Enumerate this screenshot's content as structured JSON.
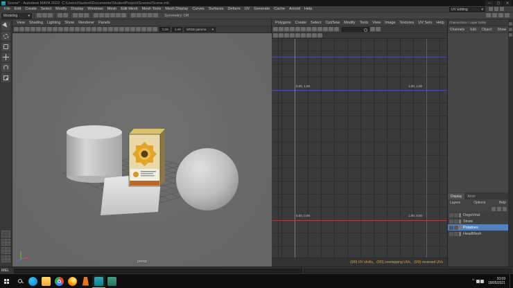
{
  "window": {
    "title": "Scene* - Autodesk MAYA 2022: C:\\Users\\Student\\Documents\\StudentProject\\Scenes\\Scene.mb",
    "minimize": "—",
    "maximize": "▢",
    "close": "✕"
  },
  "menubar": {
    "items": [
      "File",
      "Edit",
      "Create",
      "Select",
      "Modify",
      "Display",
      "Windows",
      "Mesh",
      "Edit Mesh",
      "Mesh Tools",
      "Mesh Display",
      "Curves",
      "Surfaces",
      "Deform",
      "UV",
      "Generate",
      "Cache",
      "Arnold",
      "Help"
    ],
    "workspace_value": "UV Editing",
    "right_icons": [
      "workspace-options-icon",
      "lock-ui-icon",
      "help-search-icon"
    ]
  },
  "statusline": {
    "menuset": "Modeling",
    "symmetry": "Symmetry: Off",
    "file_icons": [
      "new-scene-icon",
      "open-scene-icon",
      "save-scene-icon"
    ],
    "undo_icons": [
      "undo-icon",
      "redo-icon"
    ],
    "select_icons": [
      "select-hierarchy-icon",
      "select-object-icon",
      "select-component-icon"
    ],
    "snap_icons": [
      "snap-grid-icon",
      "snap-curve-icon",
      "snap-point-icon",
      "snap-projected-center-icon",
      "snap-view-plane-icon",
      "make-live-icon"
    ],
    "render_icons": [
      "construction-history-icon",
      "render-view-icon",
      "render-frame-icon",
      "ipr-render-icon",
      "render-settings-icon"
    ],
    "right_icons": [
      "sidebar-attribute-editor-icon",
      "sidebar-tool-settings-icon",
      "sidebar-channel-box-icon",
      "sidebar-modeling-toolkit-icon"
    ]
  },
  "toolbox": {
    "tools": [
      "select-tool",
      "lasso-tool",
      "paint-select-tool",
      "move-tool",
      "rotate-tool",
      "scale-tool"
    ],
    "layouts": [
      "single-pane-layout",
      "four-pane-layout",
      "persp-outliner-layout",
      "outliner-persp-layout"
    ]
  },
  "viewport": {
    "menus": [
      "View",
      "Shading",
      "Lighting",
      "Show",
      "Renderer",
      "Panels"
    ],
    "toolbar_icons": [
      "select-camera-icon",
      "lock-camera-icon",
      "camera-attributes-icon",
      "bookmarks-icon",
      "image-plane-icon",
      "two-d-pan-zoom-icon",
      "grease-pencil-icon",
      "grid-toggle-icon",
      "film-gate-icon",
      "resolution-gate-icon",
      "gate-mask-icon",
      "field-chart-icon",
      "safe-action-icon",
      "safe-title-icon",
      "wireframe-icon",
      "smooth-shade-icon",
      "textured-icon",
      "use-all-lights-icon",
      "shadows-icon",
      "screen-space-ao-icon",
      "anti-aliasing-icon",
      "xray-icon",
      "isolate-select-icon",
      "fog-icon",
      "depth-of-field-icon",
      "motion-blur-icon"
    ],
    "exposure": "0.00",
    "gamma": "1.00",
    "view_transform": "sRGB gamma",
    "camera_label": "persp"
  },
  "uv_editor": {
    "menus": [
      "Polygons",
      "Create",
      "Select",
      "Cut/Sew",
      "Modify",
      "Tools",
      "View",
      "Image",
      "Textures",
      "UV Sets",
      "Help"
    ],
    "toolbar_icons": [
      "uv-snapshot-icon",
      "flip-u-icon",
      "flip-v-icon",
      "rotate-ccw-icon",
      "rotate-cw-icon",
      "cut-uv-edge-icon",
      "sew-uv-edge-icon",
      "unfold-uv-icon",
      "layout-uv-icon",
      "align-uv-icon",
      "snap-together-icon",
      "optimize-uv-icon"
    ],
    "toolbar_icons_after_search": [
      "pixel-snap-icon",
      "uv-distortion-icon"
    ],
    "toolbar2_icons": [
      "dim-image-icon",
      "display-image-icon",
      "pixel-grid-icon",
      "shade-uvs-icon",
      "texture-borders-icon",
      "checker-map-icon",
      "distortion-shader-icon",
      "isolate-select-icon",
      "tile-labels-icon"
    ],
    "corner_labels": {
      "top_left": "0.00, 1.00",
      "top_right": "1.00, 1.00",
      "bottom_left": "0.00, 0.00",
      "bottom_right": "1.00, 0.00"
    },
    "status_shells": "(0/0) UV shells,",
    "status_overlapping": "(0/0) overlapping UVs,",
    "status_reversed": "(0/0) reversed UVs"
  },
  "channel_box": {
    "title": "Channel Box / Layer Editor",
    "menus": [
      "Channels",
      "Edit",
      "Object",
      "Show"
    ]
  },
  "layer_editor": {
    "tabs": [
      {
        "label": "Display",
        "active": true
      },
      {
        "label": "Anim",
        "active": false
      }
    ],
    "menus": [
      "Layers",
      "Options",
      "Help"
    ],
    "toolbar_icons": [
      "layer-options-icon",
      "new-empty-layer-icon",
      "new-layer-from-selected-icon"
    ],
    "layers": [
      {
        "name": "DogsVmd",
        "selected": false
      },
      {
        "name": "Straw",
        "selected": false
      },
      {
        "name": "Potatoes",
        "selected": true
      },
      {
        "name": "HeadMesh",
        "selected": false
      }
    ]
  },
  "command_line": {
    "label": "MEL"
  },
  "taskbar": {
    "apps": [
      "edge-icon",
      "file-explorer-icon",
      "chrome-icon",
      "firefox-icon",
      "vlc-icon",
      "maya-icon",
      "substance-icon"
    ],
    "tray": [
      "network-icon",
      "volume-icon"
    ],
    "time": "10:09",
    "date": "18/05/2021"
  }
}
